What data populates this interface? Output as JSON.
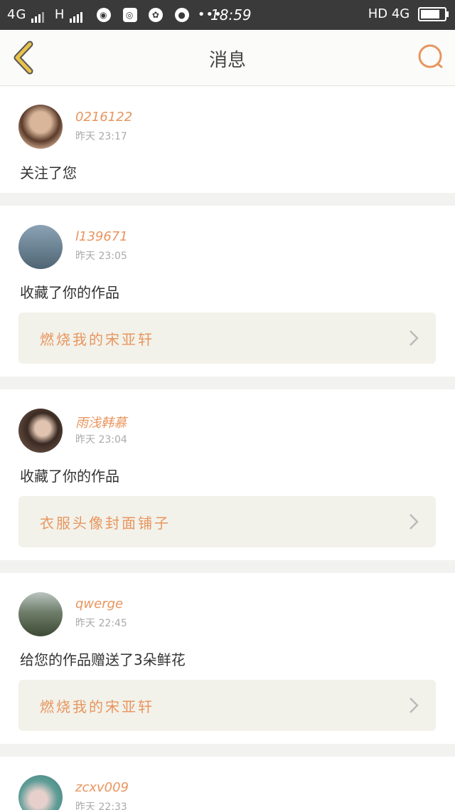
{
  "status_bar": {
    "network_left": "4G",
    "network_h": "H",
    "time": "18:59",
    "hd": "HD",
    "network_right": "4G"
  },
  "header": {
    "title": "消息",
    "back_icon": "chevron-left-icon",
    "search_icon": "search-icon"
  },
  "colors": {
    "accent": "#e8955e",
    "back": "#e8c24a",
    "card_bg": "#ffffff",
    "work_bg": "#f2f2ea"
  },
  "messages": [
    {
      "username": "0216122",
      "time": "昨天  23:17",
      "action": "关注了您"
    },
    {
      "username": "l139671",
      "time": "昨天  23:05",
      "action": "收藏了你的作品",
      "work": "燃烧我的宋亚轩"
    },
    {
      "username": "雨浅韩慕",
      "time": "昨天  23:04",
      "action": "收藏了你的作品",
      "work": "衣服头像封面铺子"
    },
    {
      "username": "qwerge",
      "time": "昨天  22:45",
      "action": "给您的作品赠送了3朵鲜花",
      "work": "燃烧我的宋亚轩"
    },
    {
      "username": "zcxv009",
      "time": "昨天  22:33"
    }
  ]
}
